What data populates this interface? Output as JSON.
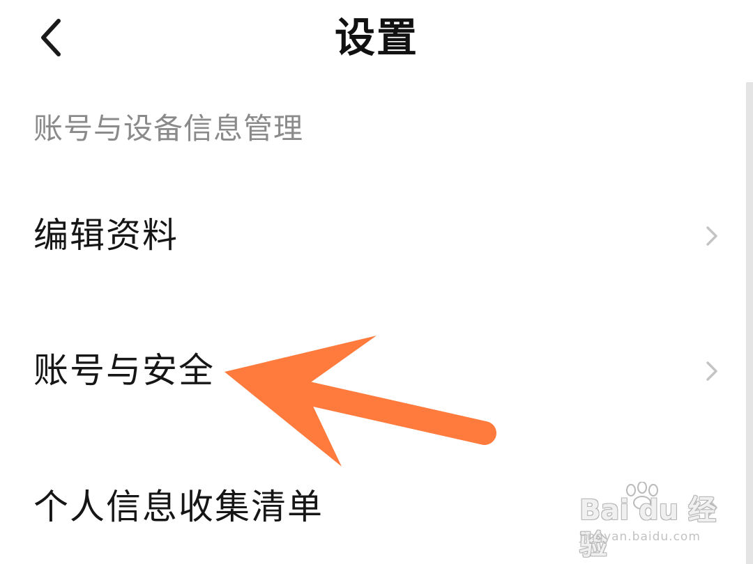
{
  "header": {
    "title": "设置",
    "back_icon": "chevron-left-icon"
  },
  "section": {
    "title": "账号与设备信息管理"
  },
  "rows": [
    {
      "label": "编辑资料",
      "icon": "chevron-right-icon"
    },
    {
      "label": "账号与安全",
      "icon": "chevron-right-icon"
    },
    {
      "label": "个人信息收集清单",
      "icon": "chevron-right-icon"
    }
  ],
  "annotation": {
    "type": "arrow",
    "color": "#FF7A3D",
    "points_to": "账号与安全"
  },
  "watermark": {
    "main": "Bai du 经验",
    "sub": "jingyan.baidu.com"
  },
  "colors": {
    "title": "#111111",
    "section_header": "#8a8a8a",
    "row_text": "#161616",
    "chevron": "#c4c4c4",
    "annotation": "#FF7A3D"
  }
}
